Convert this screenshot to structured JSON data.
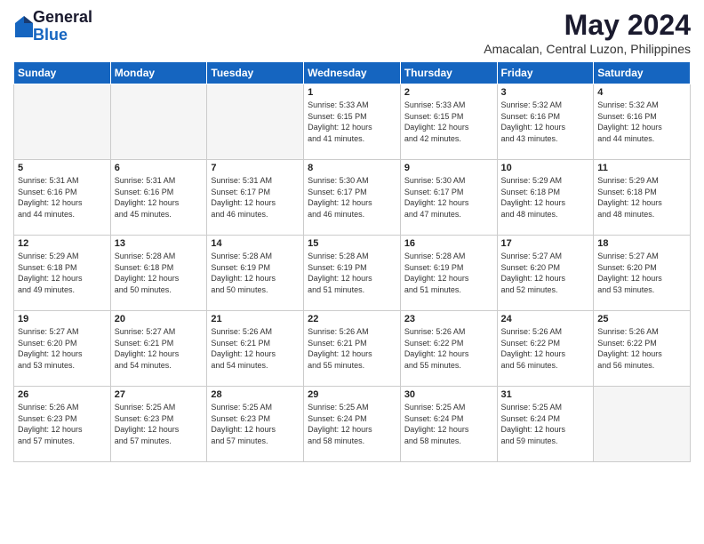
{
  "header": {
    "logo_general": "General",
    "logo_blue": "Blue",
    "title": "May 2024",
    "subtitle": "Amacalan, Central Luzon, Philippines"
  },
  "weekdays": [
    "Sunday",
    "Monday",
    "Tuesday",
    "Wednesday",
    "Thursday",
    "Friday",
    "Saturday"
  ],
  "weeks": [
    [
      {
        "day": "",
        "info": ""
      },
      {
        "day": "",
        "info": ""
      },
      {
        "day": "",
        "info": ""
      },
      {
        "day": "1",
        "info": "Sunrise: 5:33 AM\nSunset: 6:15 PM\nDaylight: 12 hours\nand 41 minutes."
      },
      {
        "day": "2",
        "info": "Sunrise: 5:33 AM\nSunset: 6:15 PM\nDaylight: 12 hours\nand 42 minutes."
      },
      {
        "day": "3",
        "info": "Sunrise: 5:32 AM\nSunset: 6:16 PM\nDaylight: 12 hours\nand 43 minutes."
      },
      {
        "day": "4",
        "info": "Sunrise: 5:32 AM\nSunset: 6:16 PM\nDaylight: 12 hours\nand 44 minutes."
      }
    ],
    [
      {
        "day": "5",
        "info": "Sunrise: 5:31 AM\nSunset: 6:16 PM\nDaylight: 12 hours\nand 44 minutes."
      },
      {
        "day": "6",
        "info": "Sunrise: 5:31 AM\nSunset: 6:16 PM\nDaylight: 12 hours\nand 45 minutes."
      },
      {
        "day": "7",
        "info": "Sunrise: 5:31 AM\nSunset: 6:17 PM\nDaylight: 12 hours\nand 46 minutes."
      },
      {
        "day": "8",
        "info": "Sunrise: 5:30 AM\nSunset: 6:17 PM\nDaylight: 12 hours\nand 46 minutes."
      },
      {
        "day": "9",
        "info": "Sunrise: 5:30 AM\nSunset: 6:17 PM\nDaylight: 12 hours\nand 47 minutes."
      },
      {
        "day": "10",
        "info": "Sunrise: 5:29 AM\nSunset: 6:18 PM\nDaylight: 12 hours\nand 48 minutes."
      },
      {
        "day": "11",
        "info": "Sunrise: 5:29 AM\nSunset: 6:18 PM\nDaylight: 12 hours\nand 48 minutes."
      }
    ],
    [
      {
        "day": "12",
        "info": "Sunrise: 5:29 AM\nSunset: 6:18 PM\nDaylight: 12 hours\nand 49 minutes."
      },
      {
        "day": "13",
        "info": "Sunrise: 5:28 AM\nSunset: 6:18 PM\nDaylight: 12 hours\nand 50 minutes."
      },
      {
        "day": "14",
        "info": "Sunrise: 5:28 AM\nSunset: 6:19 PM\nDaylight: 12 hours\nand 50 minutes."
      },
      {
        "day": "15",
        "info": "Sunrise: 5:28 AM\nSunset: 6:19 PM\nDaylight: 12 hours\nand 51 minutes."
      },
      {
        "day": "16",
        "info": "Sunrise: 5:28 AM\nSunset: 6:19 PM\nDaylight: 12 hours\nand 51 minutes."
      },
      {
        "day": "17",
        "info": "Sunrise: 5:27 AM\nSunset: 6:20 PM\nDaylight: 12 hours\nand 52 minutes."
      },
      {
        "day": "18",
        "info": "Sunrise: 5:27 AM\nSunset: 6:20 PM\nDaylight: 12 hours\nand 53 minutes."
      }
    ],
    [
      {
        "day": "19",
        "info": "Sunrise: 5:27 AM\nSunset: 6:20 PM\nDaylight: 12 hours\nand 53 minutes."
      },
      {
        "day": "20",
        "info": "Sunrise: 5:27 AM\nSunset: 6:21 PM\nDaylight: 12 hours\nand 54 minutes."
      },
      {
        "day": "21",
        "info": "Sunrise: 5:26 AM\nSunset: 6:21 PM\nDaylight: 12 hours\nand 54 minutes."
      },
      {
        "day": "22",
        "info": "Sunrise: 5:26 AM\nSunset: 6:21 PM\nDaylight: 12 hours\nand 55 minutes."
      },
      {
        "day": "23",
        "info": "Sunrise: 5:26 AM\nSunset: 6:22 PM\nDaylight: 12 hours\nand 55 minutes."
      },
      {
        "day": "24",
        "info": "Sunrise: 5:26 AM\nSunset: 6:22 PM\nDaylight: 12 hours\nand 56 minutes."
      },
      {
        "day": "25",
        "info": "Sunrise: 5:26 AM\nSunset: 6:22 PM\nDaylight: 12 hours\nand 56 minutes."
      }
    ],
    [
      {
        "day": "26",
        "info": "Sunrise: 5:26 AM\nSunset: 6:23 PM\nDaylight: 12 hours\nand 57 minutes."
      },
      {
        "day": "27",
        "info": "Sunrise: 5:25 AM\nSunset: 6:23 PM\nDaylight: 12 hours\nand 57 minutes."
      },
      {
        "day": "28",
        "info": "Sunrise: 5:25 AM\nSunset: 6:23 PM\nDaylight: 12 hours\nand 57 minutes."
      },
      {
        "day": "29",
        "info": "Sunrise: 5:25 AM\nSunset: 6:24 PM\nDaylight: 12 hours\nand 58 minutes."
      },
      {
        "day": "30",
        "info": "Sunrise: 5:25 AM\nSunset: 6:24 PM\nDaylight: 12 hours\nand 58 minutes."
      },
      {
        "day": "31",
        "info": "Sunrise: 5:25 AM\nSunset: 6:24 PM\nDaylight: 12 hours\nand 59 minutes."
      },
      {
        "day": "",
        "info": ""
      }
    ]
  ]
}
